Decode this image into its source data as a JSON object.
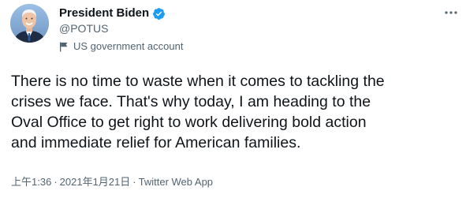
{
  "author": {
    "display_name": "President Biden",
    "handle": "@POTUS",
    "verified_icon": "verified-badge-icon",
    "account_label": "US government account",
    "label_icon": "flag-icon"
  },
  "tweet": {
    "lines": [
      "There is no time to waste when it comes to tackling the",
      "crises we face. That's why today, I am heading to the",
      "Oval Office to get right to work delivering bold action",
      "and immediate relief for American families."
    ]
  },
  "meta": {
    "time": "上午1:36",
    "separator": "·",
    "date": "2021年1月21日",
    "source": "Twitter Web App"
  },
  "colors": {
    "accent": "#1d9bf0",
    "text": "#0f1419",
    "secondary": "#536471"
  },
  "icons": {
    "more": "more-options-icon"
  }
}
